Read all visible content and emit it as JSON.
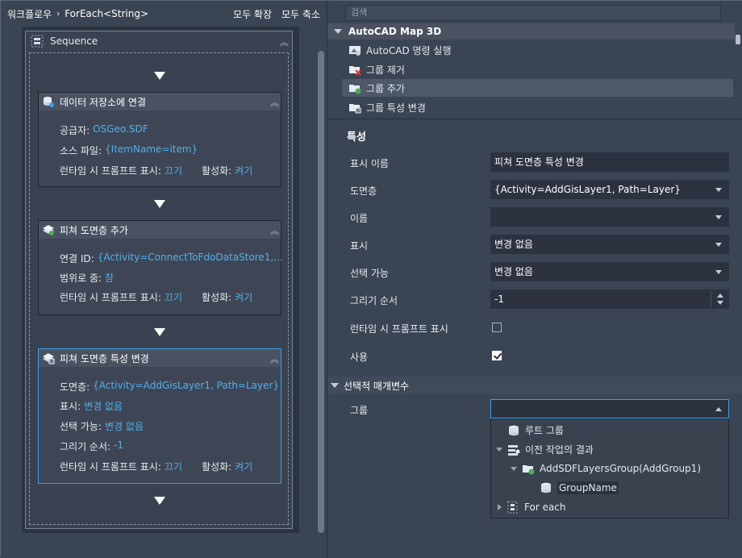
{
  "workflow": {
    "breadcrumb": [
      "워크플로우",
      "ForEach<String>"
    ],
    "breadcrumb_separator": "›",
    "expand_all": "모두 확장",
    "collapse_all": "모두 축소",
    "sequence_title": "Sequence",
    "activities": [
      {
        "title": "데이터 저장소에 연결",
        "icon": "database-connect-icon",
        "rows": [
          {
            "label": "공급자:",
            "value": "OSGeo.SDF"
          },
          {
            "label": "소스 파일:",
            "value": "{ItemName=item}"
          },
          {
            "label": "런타임 시 프롬프트 표시:",
            "value": "끄기",
            "label2": "활성화:",
            "value2": "켜기"
          }
        ]
      },
      {
        "title": "피쳐 도면층 추가",
        "icon": "add-layer-icon",
        "rows": [
          {
            "label": "연결 ID:",
            "value": "{Activity=ConnectToFdoDataStore1,..."
          },
          {
            "label": "범위로 줌:",
            "value": "참"
          },
          {
            "label": "런타임 시 프롬프트 표시:",
            "value": "끄기",
            "label2": "활성화:",
            "value2": "켜기"
          }
        ]
      },
      {
        "title": "피쳐 도면층 특성 변경",
        "icon": "layer-properties-icon",
        "rows": [
          {
            "label": "도면층:",
            "value": "{Activity=AddGisLayer1, Path=Layer}"
          },
          {
            "label": "표시:",
            "value": "변경 없음"
          },
          {
            "label": "선택 가능:",
            "value": "변경 없음"
          },
          {
            "label": "그리기 순서:",
            "value": "-1"
          },
          {
            "label": "런타임 시 프롬프트 표시:",
            "value": "끄기",
            "label2": "활성화:",
            "value2": "켜기"
          }
        ]
      }
    ]
  },
  "toolbox": {
    "search_placeholder": "검색",
    "group": "AutoCAD Map 3D",
    "items": [
      {
        "label": "AutoCAD 명령 실행",
        "icon": "command-icon"
      },
      {
        "label": "그룹 제거",
        "icon": "remove-group-icon"
      },
      {
        "label": "그룹 추가",
        "icon": "add-group-icon"
      },
      {
        "label": "그룹 특성 변경",
        "icon": "group-properties-icon"
      }
    ]
  },
  "properties": {
    "title": "특성",
    "fields": [
      {
        "label": "표시 이름",
        "value": "피쳐 도면층 특성 변경",
        "type": "text"
      },
      {
        "label": "도면층",
        "value": "{Activity=AddGisLayer1, Path=Layer}",
        "type": "dropdown"
      },
      {
        "label": "이름",
        "value": "",
        "type": "dropdown"
      },
      {
        "label": "표시",
        "value": "변경 없음",
        "type": "dropdown"
      },
      {
        "label": "선택 가능",
        "value": "변경 없음",
        "type": "dropdown"
      },
      {
        "label": "그리기 순서",
        "value": "-1",
        "type": "spinner"
      },
      {
        "label": "런타임 시 프롬프트 표시",
        "value": false,
        "type": "checkbox"
      },
      {
        "label": "사용",
        "value": true,
        "type": "checkbox"
      }
    ],
    "optional_section": "선택적 매개변수",
    "group_label": "그룹",
    "group_value": "",
    "group_options": [
      {
        "label": "루트 그룹",
        "icon": "database-icon"
      },
      {
        "label": "이전 작업의 결과",
        "icon": "previous-results-icon"
      },
      {
        "label": "AddSDFLayersGroup(AddGroup1)",
        "icon": "add-group-icon"
      },
      {
        "label": "GroupName",
        "icon": "database-icon"
      },
      {
        "label": "For each",
        "icon": "for-each-icon"
      }
    ]
  },
  "colors": {
    "accent": "#3d9ee8",
    "value_text": "#4fb0f0",
    "panel_bg": "#3b4453",
    "field_bg": "#2c3240"
  }
}
